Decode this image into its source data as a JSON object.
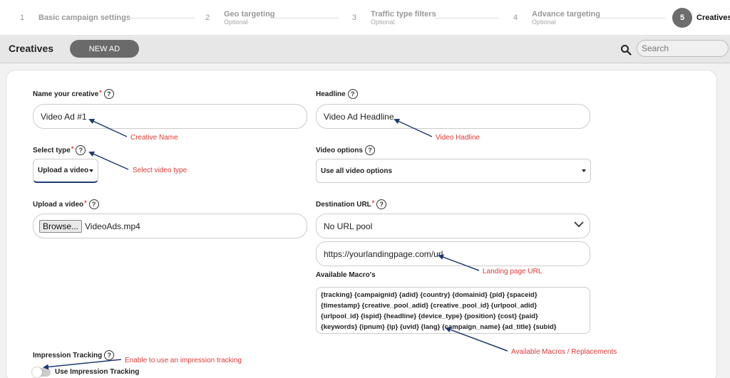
{
  "stepper": {
    "steps": [
      {
        "num": "1",
        "title": "Basic campaign settings",
        "sub": ""
      },
      {
        "num": "2",
        "title": "Geo targeting",
        "sub": "Optional"
      },
      {
        "num": "3",
        "title": "Traffic type filters",
        "sub": "Optional"
      },
      {
        "num": "4",
        "title": "Advance targeting",
        "sub": "Optional"
      }
    ],
    "active": {
      "num": "5",
      "title": "Creatives"
    }
  },
  "toolbar": {
    "title": "Creatives",
    "new_ad_label": "NEW AD",
    "search_placeholder": "Search"
  },
  "form": {
    "name_label": "Name your creative",
    "name_value": "Video Ad #1",
    "headline_label": "Headline",
    "headline_value": "Video Ad Headline",
    "type_label": "Select type",
    "type_value": "Upload a video",
    "video_options_label": "Video options",
    "video_options_value": "Use all video options",
    "upload_label": "Upload a video",
    "browse_label": "Browse...",
    "file_name": "VideoAds.mp4",
    "destination_label": "Destination URL",
    "url_pool_value": "No URL pool",
    "url_value": "https://yourlandingpage.com/url",
    "macros_label": "Available Macro's",
    "macros_lines": [
      "{tracking} {campaignid} {adid} {country} {domainid} {pid} {spaceid}",
      "{timestamp} {creative_pool_adid} {creative_pool_id} {urlpool_adid}",
      "{urlpool_id} {ispid} {headline} {device_type} {position} {cost} {paid}",
      "{keywords} {ipnum} {ip} {uvid} {lang} {campaign_name} {ad_title} {subid}"
    ],
    "impression_label": "Impression Tracking",
    "impression_toggle_label": "Use Impression Tracking",
    "required_mark": "*",
    "help_mark": "?"
  },
  "annotations": {
    "creative_name": "Creative Name",
    "video_headline": "Video Hadline",
    "select_video_type": "Select video type",
    "landing_page_url": "Landing page URL",
    "available_macros": "Available Macros / Replacements",
    "impression_tracking": "Enable to use an impression tracking"
  },
  "colors": {
    "annotation": "#e53935",
    "arrow": "#1f3b73",
    "active_step": "#6d6d6d",
    "new_ad_button": "#6a6a6a"
  }
}
